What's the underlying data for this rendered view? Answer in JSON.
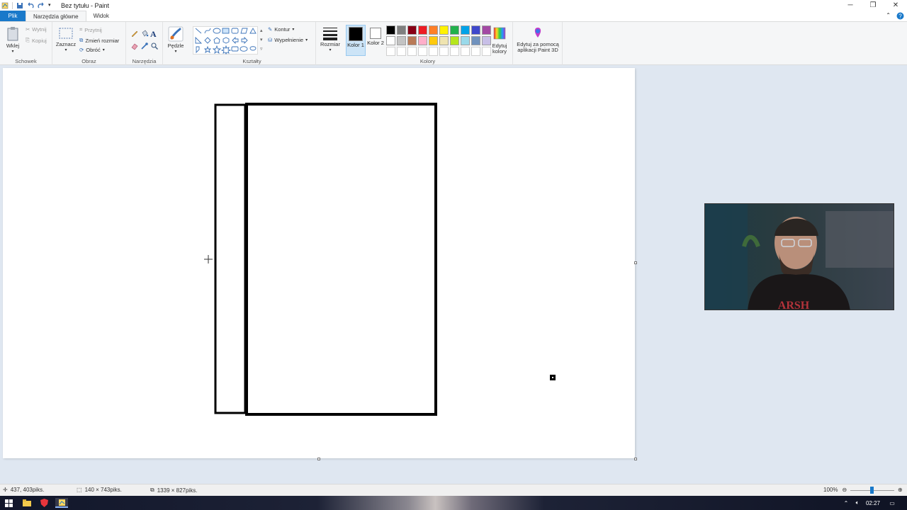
{
  "window": {
    "title": "Bez tytułu - Paint"
  },
  "tabs": [
    "Plik",
    "Narzędzia główne",
    "Widok"
  ],
  "ribbon": {
    "clipboard": {
      "paste": "Wklej",
      "cut": "Wytnij",
      "copy": "Kopiuj",
      "label": "Schowek"
    },
    "image": {
      "select": "Zaznacz",
      "crop": "Przytnij",
      "resize": "Zmień rozmiar",
      "rotate": "Obróć",
      "label": "Obraz"
    },
    "tools": {
      "label": "Narzędzia"
    },
    "brushes": {
      "label": "Pędzle"
    },
    "shapes": {
      "outline": "Kontur",
      "fill": "Wypełnienie",
      "label": "Kształty"
    },
    "size": {
      "label": "Rozmiar"
    },
    "colors": {
      "color1": "Kolor 1",
      "color2": "Kolor 2",
      "edit": "Edytuj kolory",
      "label": "Kolory",
      "color1_value": "#000000",
      "color2_value": "#ffffff",
      "palette": [
        "#000000",
        "#7f7f7f",
        "#880015",
        "#ed1c24",
        "#ff7f27",
        "#fff200",
        "#22b14c",
        "#00a2e8",
        "#3f48cc",
        "#a349a4",
        "#ffffff",
        "#c3c3c3",
        "#b97a57",
        "#ffaec9",
        "#ffc90e",
        "#efe4b0",
        "#b5e61d",
        "#99d9ea",
        "#7092be",
        "#c8bfe7",
        "#ffffff",
        "#ffffff",
        "#ffffff",
        "#ffffff",
        "#ffffff",
        "#ffffff",
        "#ffffff",
        "#ffffff",
        "#ffffff",
        "#ffffff"
      ]
    },
    "paint3d": {
      "label": "Edytuj za pomocą aplikacji Paint 3D"
    }
  },
  "status": {
    "cursor_pos": "437, 403piks.",
    "selection_size": "140 × 743piks.",
    "image_size": "1339 × 827piks.",
    "zoom": "100%"
  },
  "taskbar": {
    "time": "02:27"
  }
}
